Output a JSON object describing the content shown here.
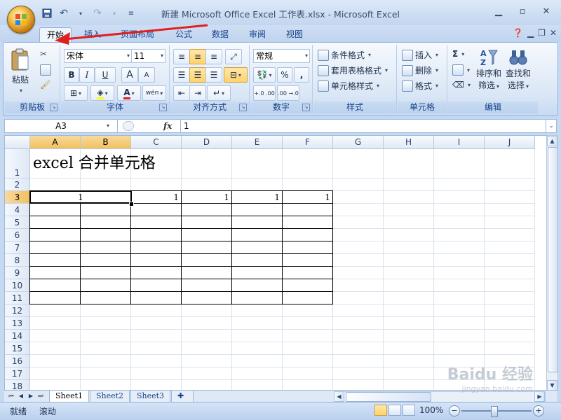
{
  "title": "新建 Microsoft Office Excel 工作表.xlsx - Microsoft Excel",
  "tabs": [
    "开始",
    "插入",
    "页面布局",
    "公式",
    "数据",
    "审阅",
    "视图"
  ],
  "active_tab": "开始",
  "ribbon": {
    "clipboard": {
      "paste": "粘贴",
      "label": "剪贴板"
    },
    "font": {
      "name": "宋体",
      "size": "11",
      "label": "字体",
      "bold": "B",
      "italic": "I",
      "underline": "U",
      "grow": "A",
      "shrink": "A"
    },
    "alignment": {
      "label": "对齐方式"
    },
    "number": {
      "format": "常规",
      "label": "数字",
      "percent": "%",
      "comma": ",",
      "inc_decimal": "+.0 .00",
      "dec_decimal": ".00 →.0"
    },
    "styles": {
      "conditional": "条件格式",
      "table": "套用表格格式",
      "cell": "单元格样式",
      "label": "样式"
    },
    "cells": {
      "insert": "插入",
      "delete": "删除",
      "format": "格式",
      "label": "单元格"
    },
    "editing": {
      "sum": "Σ",
      "sort_line1": "排序和",
      "sort_line2": "筛选",
      "find_line1": "查找和",
      "find_line2": "选择",
      "label": "编辑"
    }
  },
  "formula_bar": {
    "name_box": "A3",
    "fx": "fx",
    "value": "1"
  },
  "columns": [
    "A",
    "B",
    "C",
    "D",
    "E",
    "F",
    "G",
    "H",
    "I",
    "J"
  ],
  "rows": [
    "1",
    "2",
    "3",
    "4",
    "5",
    "6",
    "7",
    "8",
    "9",
    "10",
    "11",
    "12",
    "13",
    "14",
    "15",
    "16",
    "17",
    "18"
  ],
  "cells": {
    "A1": "excel 合并单元格",
    "A3": "1",
    "C3": "1",
    "D3": "1",
    "E3": "1",
    "F3": "1"
  },
  "sheets": [
    "Sheet1",
    "Sheet2",
    "Sheet3"
  ],
  "active_sheet": "Sheet1",
  "status": {
    "ready": "就绪",
    "scroll": "滚动",
    "zoom": "100%"
  },
  "watermark": {
    "brand": "Baidu 经验",
    "url": "jingyan.baidu.com"
  },
  "colors": {
    "accent": "#15428b",
    "selection": "#f1c15f",
    "arrow": "#e02020"
  }
}
